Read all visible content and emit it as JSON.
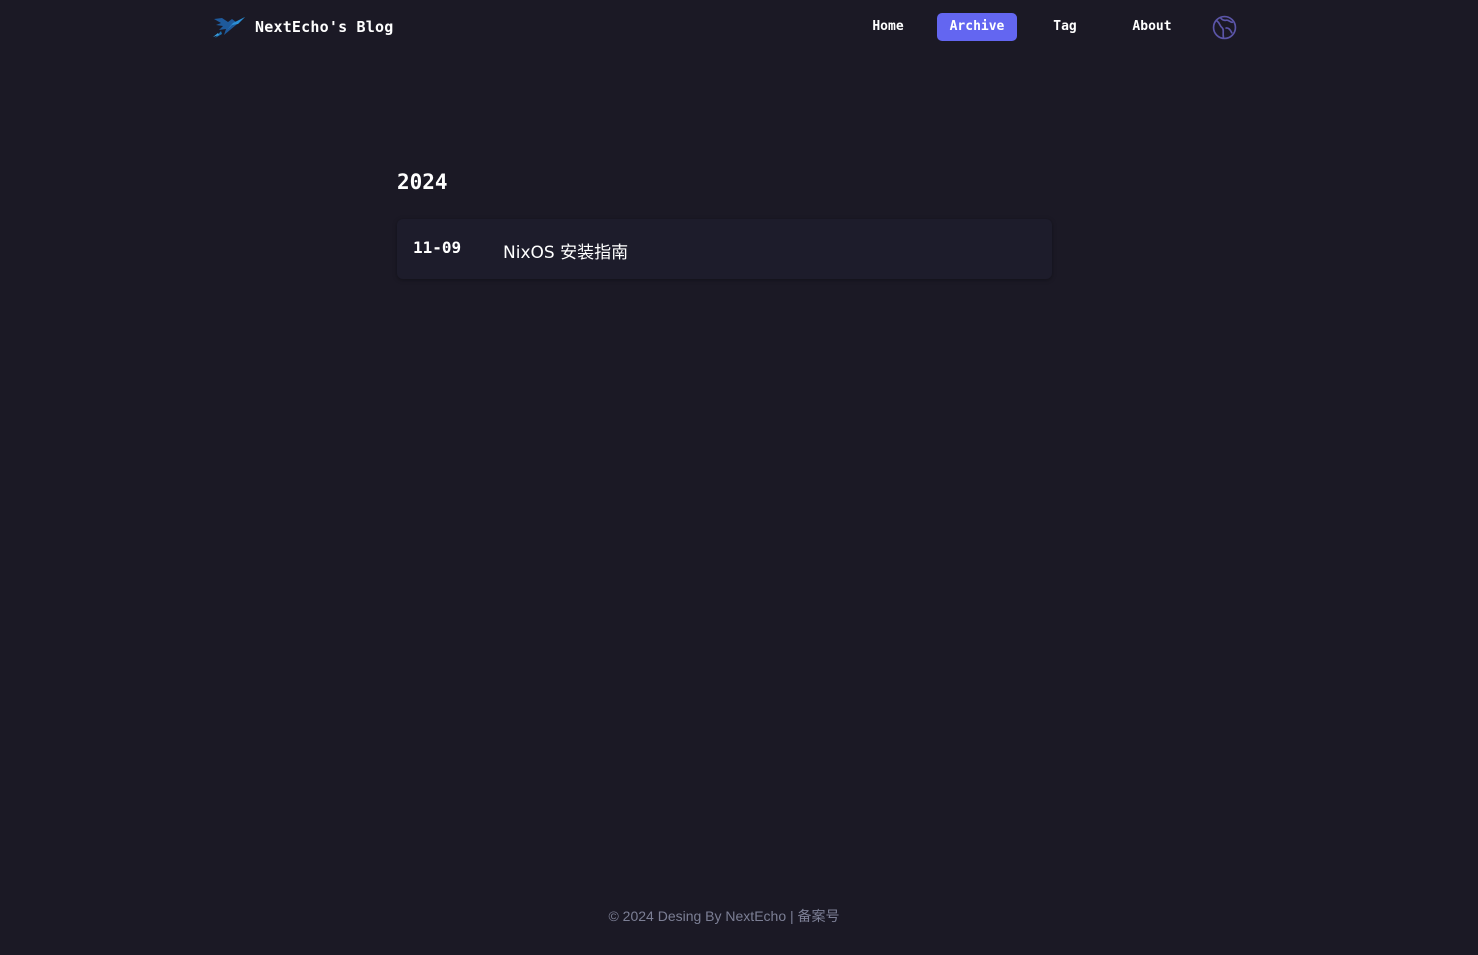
{
  "header": {
    "brand_title": "NextEcho's Blog",
    "logo_icon": "hummingbird-logo-icon",
    "nav": [
      {
        "label": "Home",
        "active": false
      },
      {
        "label": "Archive",
        "active": true
      },
      {
        "label": "Tag",
        "active": false
      },
      {
        "label": "About",
        "active": false
      }
    ],
    "language_icon": "globe-icon",
    "accent_color": "#6366f1"
  },
  "archive": {
    "year": "2024",
    "posts": [
      {
        "date": "11-09",
        "title": "NixOS 安装指南"
      }
    ]
  },
  "footer": {
    "copyright": "© 2024 Desing By NextEcho",
    "separator": "|",
    "icp_label": "备案号"
  },
  "colors": {
    "background": "#1b1925",
    "card": "#1d1c2b",
    "footer_text": "#7c7f95"
  }
}
